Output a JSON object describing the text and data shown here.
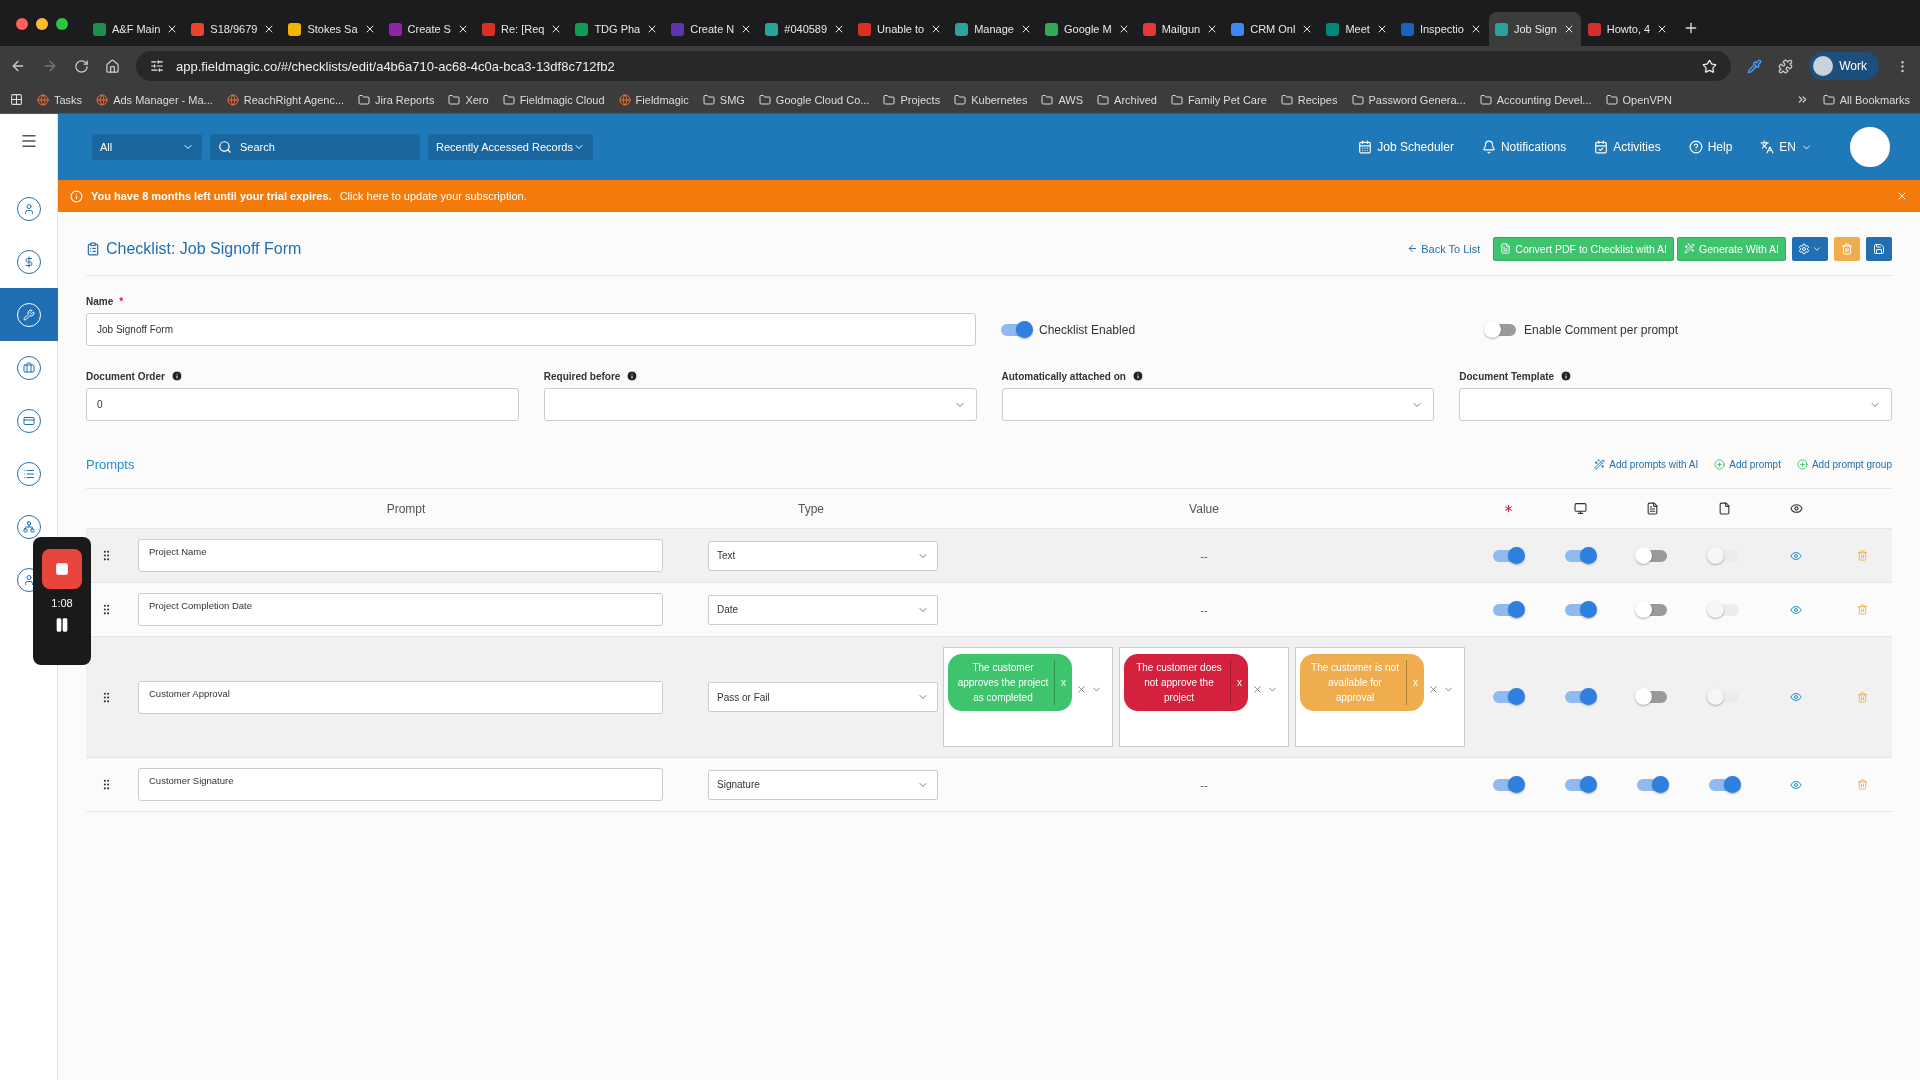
{
  "browser": {
    "tabs": [
      {
        "title": "A&F Main",
        "color": "#1f8f4e",
        "selected": false
      },
      {
        "title": "S18/9679",
        "color": "#e8452c",
        "selected": false
      },
      {
        "title": "Stokes Sa",
        "color": "#f4b400",
        "selected": false
      },
      {
        "title": "Create S",
        "color": "#8e24aa",
        "selected": false
      },
      {
        "title": "Re: [Req",
        "color": "#d93025",
        "selected": false
      },
      {
        "title": "TDG Pha",
        "color": "#0f9d58",
        "selected": false
      },
      {
        "title": "Create N",
        "color": "#5e35b1",
        "selected": false
      },
      {
        "title": "#040589",
        "color": "#26a69a",
        "selected": false
      },
      {
        "title": "Unable to",
        "color": "#d93025",
        "selected": false
      },
      {
        "title": "Manage",
        "color": "#26a69a",
        "selected": false
      },
      {
        "title": "Google M",
        "color": "#34a853",
        "selected": false
      },
      {
        "title": "Mailgun",
        "color": "#e53935",
        "selected": false
      },
      {
        "title": "CRM Onl",
        "color": "#4285f4",
        "selected": false
      },
      {
        "title": "Meet",
        "color": "#00897b",
        "selected": false
      },
      {
        "title": "Inspectio",
        "color": "#1565c0",
        "selected": false
      },
      {
        "title": "Job Sign",
        "color": "#26a69a",
        "selected": true
      },
      {
        "title": "Howto, 4",
        "color": "#d32f2f",
        "selected": false
      }
    ],
    "url": "app.fieldmagic.co/#/checklists/edit/a4b6a710-ac68-4c0a-bca3-13df8c712fb2",
    "profile": "Work",
    "bookmarks": [
      {
        "label": "Tasks",
        "kind": "site"
      },
      {
        "label": "Ads Manager - Ma...",
        "kind": "site"
      },
      {
        "label": "ReachRight Agenc...",
        "kind": "site"
      },
      {
        "label": "Jira Reports",
        "kind": "folder"
      },
      {
        "label": "Xero",
        "kind": "folder"
      },
      {
        "label": "Fieldmagic Cloud",
        "kind": "folder"
      },
      {
        "label": "Fieldmagic",
        "kind": "site"
      },
      {
        "label": "SMG",
        "kind": "folder"
      },
      {
        "label": "Google Cloud Co...",
        "kind": "folder"
      },
      {
        "label": "Projects",
        "kind": "folder"
      },
      {
        "label": "Kubernetes",
        "kind": "folder"
      },
      {
        "label": "AWS",
        "kind": "folder"
      },
      {
        "label": "Archived",
        "kind": "folder"
      },
      {
        "label": "Family Pet Care",
        "kind": "folder"
      },
      {
        "label": "Recipes",
        "kind": "folder"
      },
      {
        "label": "Password Genera...",
        "kind": "folder"
      },
      {
        "label": "Accounting Devel...",
        "kind": "folder"
      },
      {
        "label": "OpenVPN",
        "kind": "folder"
      }
    ],
    "all_bookmarks": "All Bookmarks"
  },
  "topbar": {
    "scope": "All",
    "search_placeholder": "Search",
    "recent": "Recently Accessed Records",
    "links": [
      "Job Scheduler",
      "Notifications",
      "Activities",
      "Help"
    ],
    "language": "EN"
  },
  "banner": {
    "message": "You have 8 months left until your trial expires.",
    "link": "Click here to update your subscription."
  },
  "sidebar": {
    "items": [
      {
        "kind": "contact",
        "selected": false
      },
      {
        "kind": "dollar",
        "selected": false
      },
      {
        "kind": "wrench",
        "selected": true
      },
      {
        "kind": "briefcase",
        "selected": false
      },
      {
        "kind": "card",
        "selected": false
      },
      {
        "kind": "list",
        "selected": false
      },
      {
        "kind": "network",
        "selected": false
      },
      {
        "kind": "contact",
        "selected": false
      }
    ]
  },
  "recorder": {
    "time": "1:08"
  },
  "page": {
    "title": "Checklist: Job Signoff Form",
    "back": "Back To List",
    "buttons": [
      "Convert PDF to Checklist with AI",
      "Generate With AI"
    ]
  },
  "form": {
    "name_label": "Name",
    "name_required": "*",
    "name_value": "Job Signoff Form",
    "checklist_enabled": {
      "label": "Checklist Enabled",
      "on": true
    },
    "enable_comment": {
      "label": "Enable Comment per prompt",
      "on": false
    },
    "fields": [
      {
        "label": "Document Order",
        "value": "0",
        "kind": "input"
      },
      {
        "label": "Required before",
        "kind": "select"
      },
      {
        "label": "Automatically attached on",
        "kind": "select"
      },
      {
        "label": "Document Template",
        "kind": "select"
      }
    ]
  },
  "prompts": {
    "title": "Prompts",
    "actions": [
      "Add prompts with AI",
      "Add prompt",
      "Add prompt group"
    ],
    "columns": [
      "Prompt",
      "Type",
      "Value"
    ],
    "rows": [
      {
        "prompt": "Project Name",
        "type": "Text",
        "value": "--",
        "toggles": [
          {
            "on": true,
            "disabled": false
          },
          {
            "on": true,
            "disabled": false
          },
          {
            "on": false,
            "disabled": false
          },
          {
            "on": false,
            "disabled": true
          }
        ]
      },
      {
        "prompt": "Project Completion Date",
        "type": "Date",
        "value": "--",
        "toggles": [
          {
            "on": true,
            "disabled": false
          },
          {
            "on": true,
            "disabled": false
          },
          {
            "on": false,
            "disabled": false
          },
          {
            "on": false,
            "disabled": true
          }
        ]
      },
      {
        "prompt": "Customer Approval",
        "type": "Pass or Fail",
        "options": [
          {
            "text": "The customer approves the project as completed",
            "remove": "x",
            "color": "#3ec46d"
          },
          {
            "text": "The customer does not approve the project",
            "remove": "x",
            "color": "#d4213d"
          },
          {
            "text": "The customer is not available for approval",
            "remove": "x",
            "color": "#f0ad4e"
          }
        ],
        "toggles": [
          {
            "on": true,
            "disabled": false
          },
          {
            "on": true,
            "disabled": false
          },
          {
            "on": false,
            "disabled": false
          },
          {
            "on": false,
            "disabled": true
          }
        ]
      },
      {
        "prompt": "Customer Signature",
        "type": "Signature",
        "value": "--",
        "toggles": [
          {
            "on": true,
            "disabled": false
          },
          {
            "on": true,
            "disabled": false
          },
          {
            "on": true,
            "disabled": false
          },
          {
            "on": true,
            "disabled": false
          }
        ]
      }
    ]
  }
}
